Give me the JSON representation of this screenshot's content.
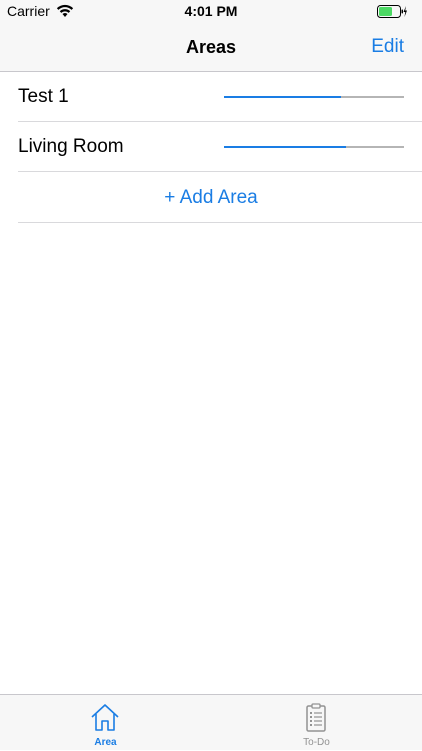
{
  "status_bar": {
    "carrier": "Carrier",
    "time": "4:01 PM",
    "wifi_icon": "wifi-icon",
    "battery_icon": "battery-charging-icon",
    "battery_color": "#4cd964"
  },
  "nav_bar": {
    "title": "Areas",
    "edit_label": "Edit"
  },
  "areas": [
    {
      "label": "Test 1",
      "progress": 0.65
    },
    {
      "label": "Living Room",
      "progress": 0.68
    }
  ],
  "add_area_label": "+ Add Area",
  "tab_bar": {
    "tabs": [
      {
        "label": "Area",
        "icon": "house-icon",
        "selected": true
      },
      {
        "label": "To-Do",
        "icon": "clipboard-icon",
        "selected": false
      }
    ]
  },
  "colors": {
    "accent": "#1a7de4",
    "track": "#b5b5b5",
    "inactive_tab": "#929292"
  }
}
